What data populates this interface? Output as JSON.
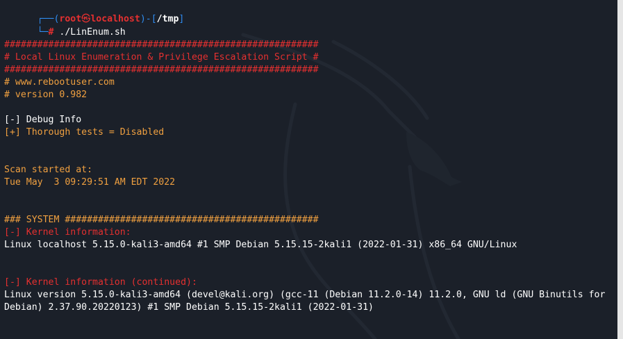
{
  "prompt": {
    "line1_prefix": "┌──(",
    "user": "root",
    "at_symbol": "㉿",
    "host": "localhost",
    "path_open": ")-[",
    "path": "/tmp",
    "path_close": "]",
    "line2_prefix": "└─",
    "prompt_char": "#",
    "command": " ./LinEnum.sh"
  },
  "banner": {
    "hash_line": "#########################################################",
    "title": "# Local Linux Enumeration & Privilege Escalation Script #",
    "website": "# www.rebootuser.com",
    "version": "# version 0.982"
  },
  "debug": {
    "debug_info": "[-] Debug Info",
    "thorough_tests": "[+] Thorough tests = Disabled"
  },
  "scan": {
    "started_label": "Scan started at:",
    "started_time": "Tue May  3 09:29:51 AM EDT 2022"
  },
  "system": {
    "header": "### SYSTEM ##############################################",
    "kernel_label": "[-] Kernel information:",
    "kernel_value": "Linux localhost 5.15.0-kali3-amd64 #1 SMP Debian 5.15.15-2kali1 (2022-01-31) x86_64 GNU/Linux",
    "kernel_cont_label": "[-] Kernel information (continued):",
    "kernel_cont_value_1": "Linux version 5.15.0-kali3-amd64 (devel@kali.org) (gcc-11 (Debian 11.2.0-14) 11.2.0, GNU ld (GNU Binutils for",
    "kernel_cont_value_2": "Debian) 2.37.90.20220123) #1 SMP Debian 5.15.15-2kali1 (2022-01-31)"
  },
  "colors": {
    "background": "#1b2029",
    "prompt_blue": "#2f8cf0",
    "prompt_red": "#e53030",
    "banner_red": "#e53030",
    "label_orange": "#f0a040",
    "text_white": "#ffffff"
  }
}
